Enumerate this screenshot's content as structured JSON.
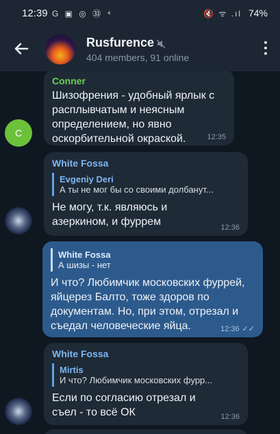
{
  "statusbar": {
    "time": "12:39",
    "left_icons": "G ▣ ◎ ㉝ ⁴",
    "right_icons": "🔇 ᯤ .ıl",
    "battery": "74%"
  },
  "header": {
    "title": "Rusfurence",
    "members": "404 members, 91 online"
  },
  "messages": [
    {
      "author": "Conner",
      "author_color": "#6ccf53",
      "text": "Шизофрения - удобный ярлык с расплывчатым и неясным определением, но явно оскорбительной окраской.",
      "time": "12:35",
      "avatar_letter": "C"
    },
    {
      "author": "White Fossa",
      "author_color": "#7db6f1",
      "reply_name": "Evgeniy Deri",
      "reply_text": "А ты не мог бы со своими долбанут...",
      "text": "Не могу, т.к. являюсь и азеркином, и фуррем",
      "time": "12:36"
    },
    {
      "outgoing": true,
      "reply_name": "White Fossa",
      "reply_text": "А шизы - нет",
      "text": "И что? Любимчик московских фуррей, яйцерез Балто, тоже здоров по документам. Но, при этом, отрезал и съедал человеческие яйца.",
      "time": "12:36",
      "status": "✓✓"
    },
    {
      "author": "White Fossa",
      "author_color": "#7db6f1",
      "reply_name": "Mirtis",
      "reply_text": "И что? Любимчик московских фурр...",
      "text": "Если по согласию отрезал и съел - то всё ОК",
      "time": "12:36"
    }
  ]
}
